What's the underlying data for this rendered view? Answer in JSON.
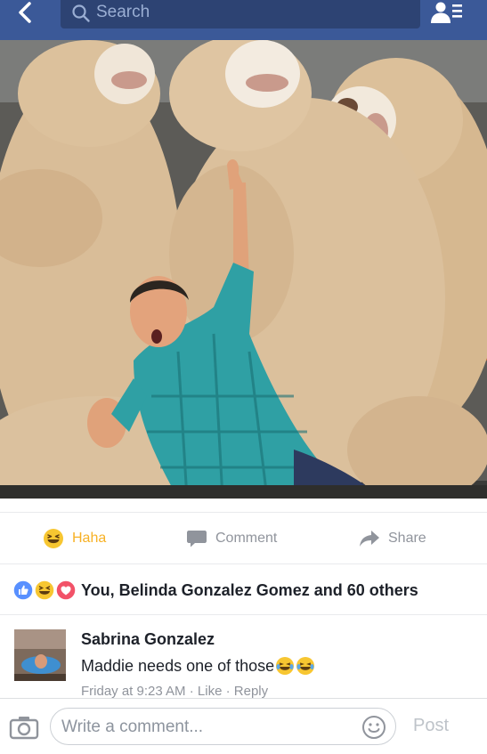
{
  "topbar": {
    "search_placeholder": "Search",
    "back_icon": "chevron-left-icon",
    "friends_icon": "friend-requests-icon",
    "bar_color": "#3b5998"
  },
  "photo": {
    "icon": "post-photo"
  },
  "actions": {
    "haha_label": "Haha",
    "comment_label": "Comment",
    "share_label": "Share",
    "haha_color": "#f7b125"
  },
  "reactions": {
    "icons": [
      "like-reaction-icon",
      "haha-reaction-icon",
      "love-reaction-icon"
    ],
    "summary": "You, Belinda Gonzalez Gomez and 60 others"
  },
  "comment": {
    "author": "Sabrina Gonzalez",
    "text": "Maddie needs one of those",
    "emoji": [
      "tears-of-joy-emoji",
      "tears-of-joy-emoji"
    ],
    "time": "Friday at 9:23 AM",
    "sep1": " · ",
    "like_label": "Like",
    "sep2": " · ",
    "reply_label": "Reply"
  },
  "composer": {
    "placeholder": "Write a comment...",
    "post_label": "Post"
  }
}
